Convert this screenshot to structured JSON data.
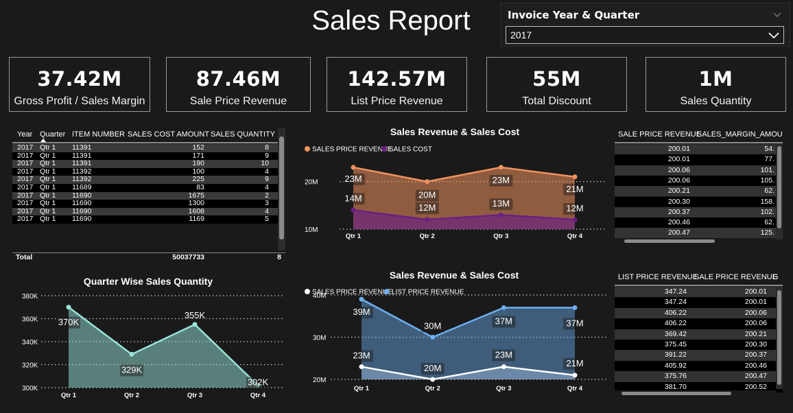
{
  "header": {
    "title": "Sales Report"
  },
  "slicer": {
    "label": "Invoice Year & Quarter",
    "value": "2017"
  },
  "cards": [
    {
      "value": "37.42M",
      "label": "Gross Profit / Sales Margin"
    },
    {
      "value": "87.46M",
      "label": "Sale Price Revenue"
    },
    {
      "value": "142.57M",
      "label": "List Price Revenue"
    },
    {
      "value": "55M",
      "label": "Total Discount"
    },
    {
      "value": "1M",
      "label": "Sales Quantity"
    }
  ],
  "table1": {
    "columns": [
      "Year",
      "Quarter",
      "ITEM NUMBER",
      "SALES COST AMOUNT",
      "SALES QUANTITY"
    ],
    "rows": [
      [
        "2017",
        "Qtr 1",
        "11391",
        "152",
        "8"
      ],
      [
        "2017",
        "Qtr 1",
        "11391",
        "171",
        "9"
      ],
      [
        "2017",
        "Qtr 1",
        "11391",
        "190",
        "10"
      ],
      [
        "2017",
        "Qtr 1",
        "11392",
        "100",
        "4"
      ],
      [
        "2017",
        "Qtr 1",
        "11392",
        "225",
        "9"
      ],
      [
        "2017",
        "Qtr 1",
        "11689",
        "83",
        "4"
      ],
      [
        "2017",
        "Qtr 1",
        "11690",
        "1675",
        "2"
      ],
      [
        "2017",
        "Qtr 1",
        "11690",
        "1300",
        "3"
      ],
      [
        "2017",
        "Qtr 1",
        "11690",
        "1608",
        "4"
      ],
      [
        "2017",
        "Qtr 1",
        "11690",
        "1169",
        "5"
      ]
    ],
    "total_label": "Total",
    "total_cost": "50037733",
    "total_qty": "8"
  },
  "table2": {
    "columns": [
      "SALE PRICE REVENUE",
      "SALES_MARGIN_AMOU"
    ],
    "rows": [
      [
        "200.01",
        "54."
      ],
      [
        "200.01",
        "77."
      ],
      [
        "200.06",
        "101."
      ],
      [
        "200.06",
        "105."
      ],
      [
        "200.21",
        "62."
      ],
      [
        "200.30",
        "158."
      ],
      [
        "200.37",
        "102."
      ],
      [
        "200.46",
        "62."
      ],
      [
        "200.47",
        "125."
      ]
    ]
  },
  "table3": {
    "columns": [
      "LIST PRICE REVENUE",
      "SALE PRICE REVENUE",
      "G"
    ],
    "rows": [
      [
        "347.24",
        "200.01"
      ],
      [
        "347.24",
        "200.01"
      ],
      [
        "406.22",
        "200.06"
      ],
      [
        "406.22",
        "200.06"
      ],
      [
        "369.42",
        "200.21"
      ],
      [
        "375.45",
        "200.30"
      ],
      [
        "391.22",
        "200.37"
      ],
      [
        "405.92",
        "200.46"
      ],
      [
        "375.76",
        "200.47"
      ],
      [
        "381.70",
        "200.52"
      ]
    ]
  },
  "colors": {
    "background": "#1b1a1a",
    "orange": "#f0935f",
    "purple": "#6a1f83",
    "teal": "#98e3d9",
    "blue": "#6cb0f2",
    "white": "#ffffff",
    "row_alt": "#333333"
  },
  "icons": {
    "slicer_collapse": "chevron-down-icon",
    "dropdown": "chevron-down-icon"
  },
  "chart_data": [
    {
      "type": "area",
      "title": "Sales Revenue & Sales Cost",
      "categories": [
        "Qtr 1",
        "Qtr 2",
        "Qtr 3",
        "Qtr 4"
      ],
      "series": [
        {
          "name": "SALES PRICE REVENUE",
          "values": [
            23,
            20,
            23,
            21
          ],
          "labels": [
            "23M",
            "20M",
            "23M",
            "21M"
          ],
          "color": "#f0935f"
        },
        {
          "name": "SALES COST",
          "values": [
            14,
            12,
            13,
            12
          ],
          "labels": [
            "14M",
            "12M",
            "13M",
            "12M"
          ],
          "color": "#6a1f83"
        }
      ],
      "yticks": [
        "20M",
        "10M"
      ],
      "ylim": [
        10,
        24
      ],
      "legend": "top-left",
      "grid": true
    },
    {
      "type": "area",
      "title": "Quarter Wise Sales Quantity",
      "categories": [
        "Qtr 1",
        "Qtr 2",
        "Qtr 3",
        "Qtr 4"
      ],
      "series": [
        {
          "values": [
            370,
            329,
            355,
            302
          ],
          "labels": [
            "370K",
            "329K",
            "355K",
            "302K"
          ],
          "color": "#98e3d9"
        }
      ],
      "yticks": [
        "380K",
        "360K",
        "340K",
        "320K",
        "300K"
      ],
      "ylim": [
        300,
        380
      ],
      "grid": true
    },
    {
      "type": "area",
      "title": "Sales Revenue & Sales Cost",
      "categories": [
        "Qtr 1",
        "Qtr 2",
        "Qtr 3",
        "Qtr 4"
      ],
      "series": [
        {
          "name": "SALES PRICE REVENUE",
          "values": [
            23,
            20,
            23,
            21
          ],
          "labels": [
            "23M",
            "20M",
            "23M",
            "21M"
          ],
          "color": "#ffffff"
        },
        {
          "name": "LIST PRICE REVENUE",
          "values": [
            39,
            30,
            37,
            37
          ],
          "labels": [
            "39M",
            "30M",
            "37M",
            "37M"
          ],
          "color": "#6cb0f2"
        }
      ],
      "yticks": [
        "40M",
        "30M",
        "20M"
      ],
      "ylim": [
        20,
        40
      ],
      "legend": "top-left",
      "grid": true
    }
  ]
}
